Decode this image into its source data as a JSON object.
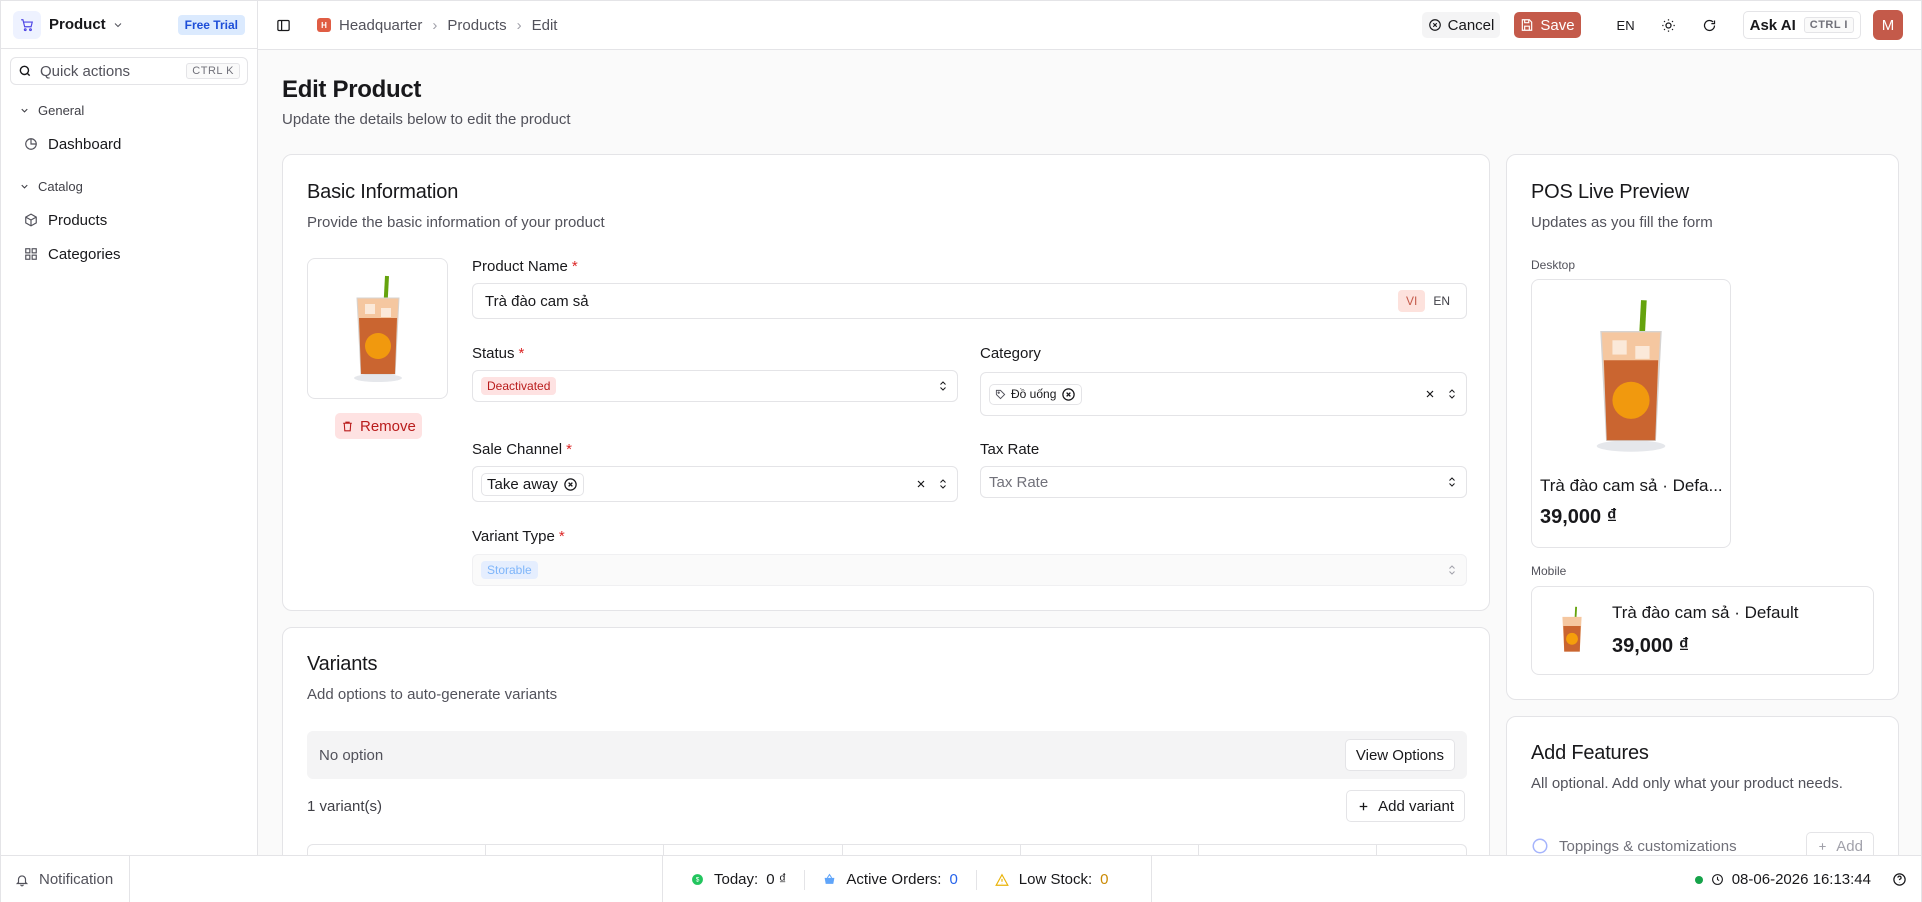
{
  "sidebar": {
    "app_title": "Product",
    "trial_badge": "Free Trial",
    "quick_actions": "Quick actions",
    "quick_shortcut": "CTRL K",
    "groups": [
      {
        "label": "General",
        "items": [
          {
            "label": "Dashboard",
            "icon": "dashboard-icon"
          }
        ]
      },
      {
        "label": "Catalog",
        "items": [
          {
            "label": "Products",
            "icon": "box-icon"
          },
          {
            "label": "Categories",
            "icon": "grid-icon"
          }
        ]
      }
    ]
  },
  "header": {
    "breadcrumb": [
      "Headquarter",
      "Products",
      "Edit"
    ],
    "hq_initial": "H",
    "cancel": "Cancel",
    "save": "Save",
    "language": "EN",
    "ask_ai": "Ask AI",
    "ask_shortcut": "CTRL I",
    "avatar": "M"
  },
  "page": {
    "title": "Edit Product",
    "subtitle": "Update the details below to edit the product"
  },
  "basic": {
    "title": "Basic Information",
    "subtitle": "Provide the basic information of your product",
    "remove": "Remove",
    "product_name_label": "Product Name",
    "product_name_value": "Trà đào cam sả",
    "lang_vi": "VI",
    "lang_en": "EN",
    "status_label": "Status",
    "status_value": "Deactivated",
    "category_label": "Category",
    "category_value": "Đồ uống",
    "sale_channel_label": "Sale Channel",
    "sale_channel_value": "Take away",
    "tax_rate_label": "Tax Rate",
    "tax_rate_placeholder": "Tax Rate",
    "variant_type_label": "Variant Type",
    "variant_type_value": "Storable"
  },
  "variants": {
    "title": "Variants",
    "subtitle": "Add options to auto-generate variants",
    "no_option": "No option",
    "view_options": "View Options",
    "count": "1 variant(s)",
    "add_variant": "Add variant"
  },
  "preview": {
    "title": "POS Live Preview",
    "subtitle": "Updates as you fill the form",
    "desktop_label": "Desktop",
    "desktop_name": "Trà đào cam sả · Defa...",
    "desktop_price": "39,000 ₫",
    "mobile_label": "Mobile",
    "mobile_name": "Trà đào cam sả · Default",
    "mobile_price": "39,000 ₫"
  },
  "features": {
    "title": "Add Features",
    "subtitle": "All optional. Add only what your product needs.",
    "item": "Toppings & customizations",
    "add": "Add"
  },
  "footer": {
    "notification": "Notification",
    "today_label": "Today:",
    "today_value": "0 ₫",
    "orders_label": "Active Orders:",
    "orders_value": "0",
    "low_stock_label": "Low Stock:",
    "low_stock_value": "0",
    "datetime": "08-06-2026 16:13:44"
  },
  "colors": {
    "accent": "#c45a4a",
    "trial": "#1d4ed8",
    "danger": "#b91c1c",
    "online": "#16a34a"
  }
}
